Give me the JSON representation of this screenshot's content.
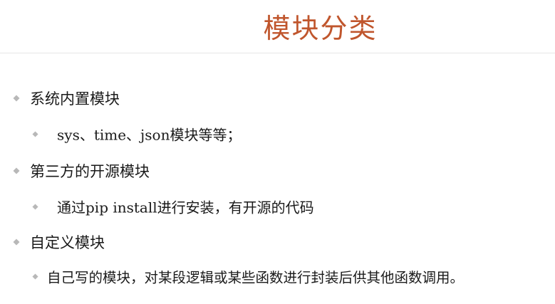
{
  "slide": {
    "title": "模块分类",
    "bullets": [
      {
        "level": 1,
        "text": "系统内置模块"
      },
      {
        "level": 2,
        "text": "sys、time、json模块等等；"
      },
      {
        "level": 1,
        "text": "第三方的开源模块"
      },
      {
        "level": 2,
        "text": "通过pip install进行安装，有开源的代码"
      },
      {
        "level": 1,
        "text": "自定义模块"
      },
      {
        "level": 2,
        "text": "自己写的模块，对某段逻辑或某些函数进行封装后供其他函数调用。"
      }
    ]
  },
  "colors": {
    "title": "#c0562d",
    "text": "#1a1a1a",
    "marker": "#b8b8b8",
    "divider": "#e6e6e6"
  },
  "icons": {
    "bullet_marker": "diamond-bullet-icon"
  }
}
